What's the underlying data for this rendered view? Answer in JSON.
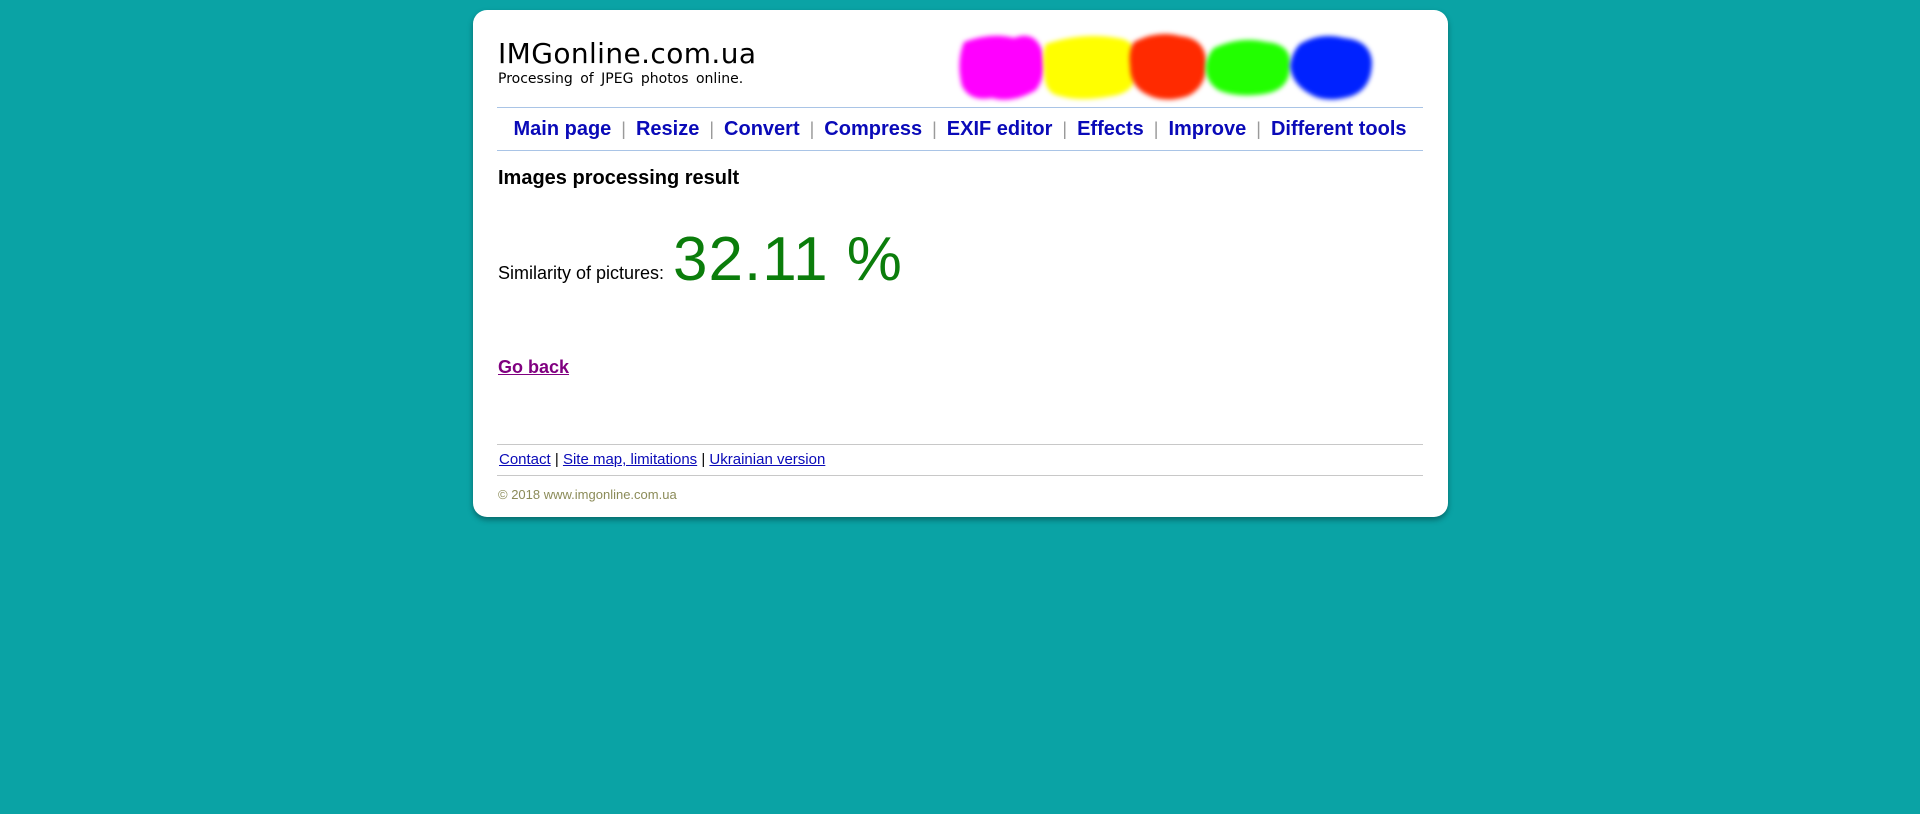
{
  "header": {
    "title": "IMGonline.com.ua",
    "tagline": "Processing of JPEG photos online.",
    "blob_colors": [
      "#ff00ff",
      "#ffff00",
      "#ff2a00",
      "#22ff00",
      "#0022ff"
    ]
  },
  "nav": {
    "items": [
      "Main page",
      "Resize",
      "Convert",
      "Compress",
      "EXIF editor",
      "Effects",
      "Improve",
      "Different tools"
    ],
    "separator": "|"
  },
  "main": {
    "heading": "Images processing result",
    "similarity_label": "Similarity of pictures:",
    "similarity_value": "32.11 %",
    "go_back": "Go back"
  },
  "footer": {
    "links": [
      "Contact",
      "Site map, limitations",
      "Ukrainian version"
    ],
    "separator": "|",
    "copyright": "© 2018 www.imgonline.com.ua"
  },
  "colors": {
    "background": "#0aa3a5",
    "link": "#0a0ab8",
    "visited_link": "#800080",
    "similarity": "#0b7d0b"
  }
}
